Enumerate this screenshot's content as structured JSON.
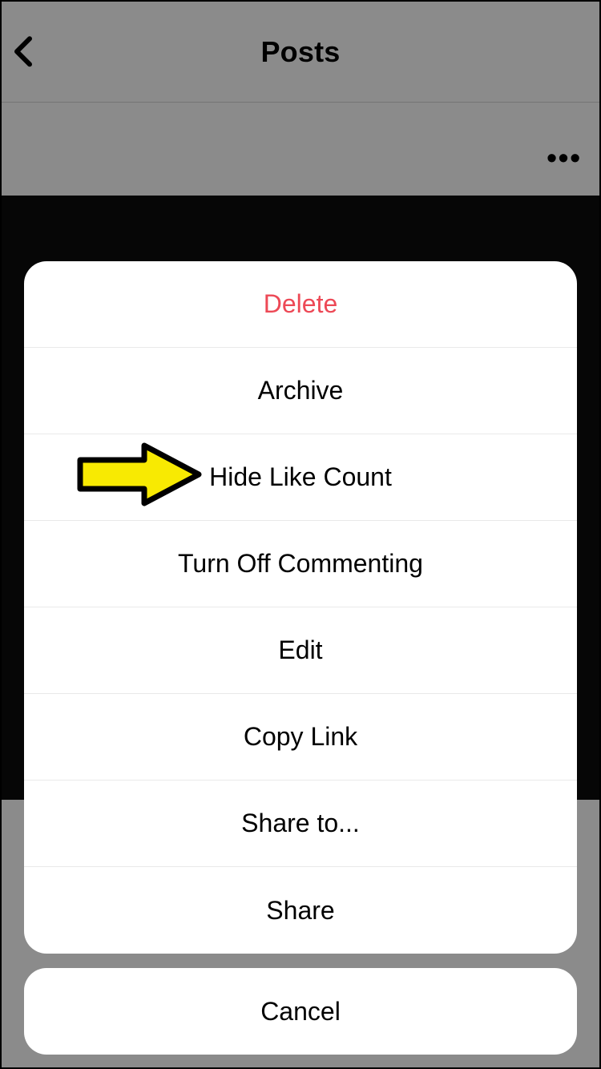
{
  "header": {
    "title": "Posts"
  },
  "actionSheet": {
    "items": [
      {
        "label": "Delete",
        "destructive": true,
        "key": "delete"
      },
      {
        "label": "Archive",
        "destructive": false,
        "key": "archive"
      },
      {
        "label": "Hide Like Count",
        "destructive": false,
        "key": "hide-like-count",
        "highlighted": true
      },
      {
        "label": "Turn Off Commenting",
        "destructive": false,
        "key": "turn-off-commenting"
      },
      {
        "label": "Edit",
        "destructive": false,
        "key": "edit"
      },
      {
        "label": "Copy Link",
        "destructive": false,
        "key": "copy-link"
      },
      {
        "label": "Share to...",
        "destructive": false,
        "key": "share-to"
      },
      {
        "label": "Share",
        "destructive": false,
        "key": "share"
      }
    ],
    "cancel": "Cancel"
  }
}
